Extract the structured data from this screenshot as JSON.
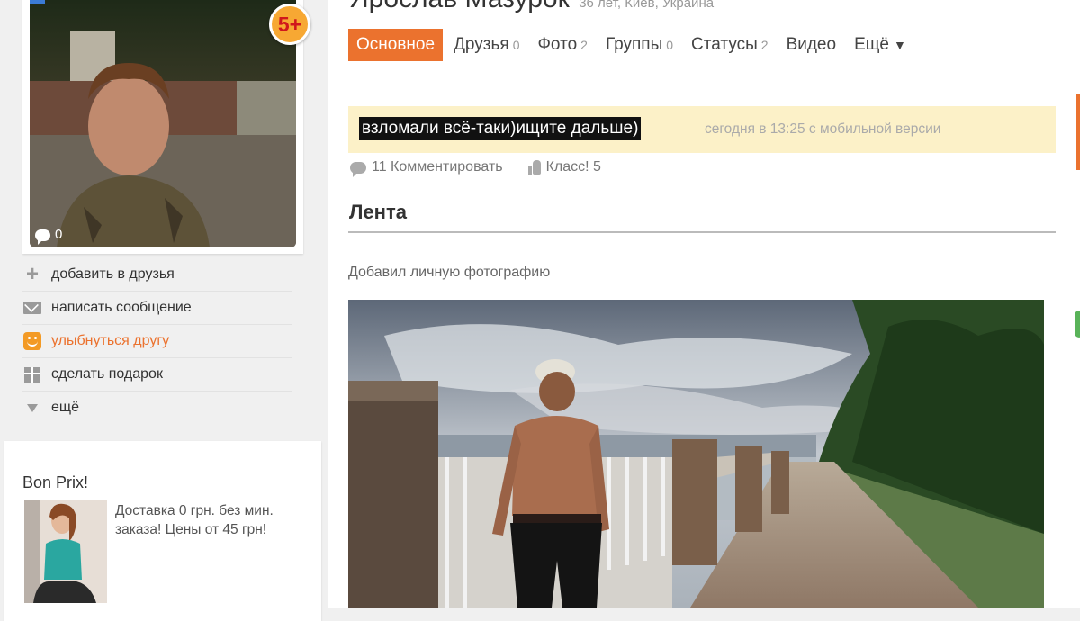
{
  "profile": {
    "name": "Ярослав Мазурок",
    "meta": "36 лет, Киев, Украина",
    "age_badge": "5+",
    "photo_comments": "0"
  },
  "tabs": [
    {
      "label": "Основное",
      "count": "",
      "active": true
    },
    {
      "label": "Друзья",
      "count": "0"
    },
    {
      "label": "Фото",
      "count": "2"
    },
    {
      "label": "Группы",
      "count": "0"
    },
    {
      "label": "Статусы",
      "count": "2"
    },
    {
      "label": "Видео",
      "count": ""
    },
    {
      "label": "Ещё",
      "count": ""
    }
  ],
  "actions": [
    {
      "label": "добавить в друзья",
      "icon": "plus-icon"
    },
    {
      "label": "написать сообщение",
      "icon": "envelope-icon"
    },
    {
      "label": "улыбнуться другу",
      "icon": "smile-icon"
    },
    {
      "label": "сделать подарок",
      "icon": "gift-icon"
    },
    {
      "label": "ещё",
      "icon": "triangle-down-icon"
    }
  ],
  "status": {
    "text": "взломали всё-таки)ищите дальше)",
    "meta": "сегодня в 13:25  с мобильной версии",
    "comments_label": "11 Комментировать",
    "like_label": "Класс! 5"
  },
  "feed": {
    "title": "Лента",
    "subtitle": "Добавил личную фотографию"
  },
  "ad": {
    "title": "Bon Prix!",
    "text": "Доставка 0 грн. без мин. заказа! Цены от 45 грн!"
  },
  "colors": {
    "accent": "#eb722e",
    "status_bg": "#fcf1c8"
  }
}
